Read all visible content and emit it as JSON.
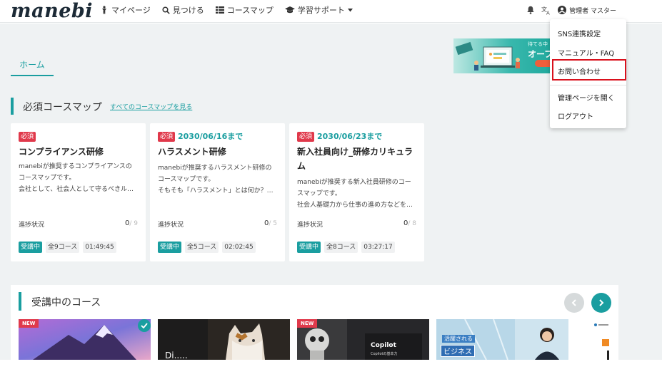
{
  "header": {
    "logo": "manebi",
    "nav": [
      {
        "label": "マイページ",
        "icon": "person-icon"
      },
      {
        "label": "見つける",
        "icon": "search-icon"
      },
      {
        "label": "コースマップ",
        "icon": "list-icon"
      },
      {
        "label": "学習サポート",
        "icon": "graduation-cap-icon",
        "dropdown": true
      }
    ],
    "user_label": "管理者 マスター",
    "icons": [
      "bell-icon",
      "translate-icon",
      "user-circle-icon"
    ]
  },
  "tabs": {
    "home": "ホーム"
  },
  "banner": {
    "line1": "待てる中",
    "line2": "オープ"
  },
  "required_section": {
    "title": "必須コースマップ",
    "see_all": "すべてのコースマップを見る",
    "cards": [
      {
        "badge": "必須",
        "deadline": "",
        "title": "コンプライアンス研修",
        "desc": [
          "manebiが推奨するコンプライアンスの",
          "コースマップです。",
          "会社として、社会人として守るべきル…"
        ],
        "progress_label": "進捗状況",
        "progress_done": "0",
        "progress_total": "/ 9",
        "status": "受講中",
        "course_count": "全9コース",
        "duration": "01:49:45"
      },
      {
        "badge": "必須",
        "deadline": "2030/06/16まで",
        "title": "ハラスメント研修",
        "desc": [
          "manebiが推奨するハラスメント研修の",
          "コースマップです。",
          "そもそも「ハラスメント」とは何か？…"
        ],
        "progress_label": "進捗状況",
        "progress_done": "0",
        "progress_total": "/ 5",
        "status": "受講中",
        "course_count": "全5コース",
        "duration": "02:02:45"
      },
      {
        "badge": "必須",
        "deadline": "2030/06/23まで",
        "title": "新入社員向け_研修カリキュラム",
        "desc": [
          "manebiが推奨する新入社員研修のコー",
          "スマップです。",
          "社会人基礎力から仕事の進め方などを…"
        ],
        "progress_label": "進捗状況",
        "progress_done": "0",
        "progress_total": "/ 8",
        "status": "受講中",
        "course_count": "全8コース",
        "duration": "03:27:17"
      }
    ]
  },
  "enrolled_section": {
    "title": "受講中のコース",
    "thumbs": [
      {
        "new_badge": "NEW",
        "completed": true
      },
      {
        "caption": "Di....."
      },
      {
        "new_badge": "NEW",
        "caption": "Copilot",
        "sub": "Copilotの基本力"
      },
      {
        "tag1": "活躍される",
        "tag2": "ビジネス"
      }
    ]
  },
  "dropdown": {
    "items": [
      "SNS連携設定",
      "マニュアル・FAQ",
      "お問い合わせ",
      "管理ページを開く",
      "ログアウト"
    ]
  },
  "colors": {
    "accent": "#1a9ea0",
    "required": "#e0394b",
    "highlight": "#d9101c"
  }
}
